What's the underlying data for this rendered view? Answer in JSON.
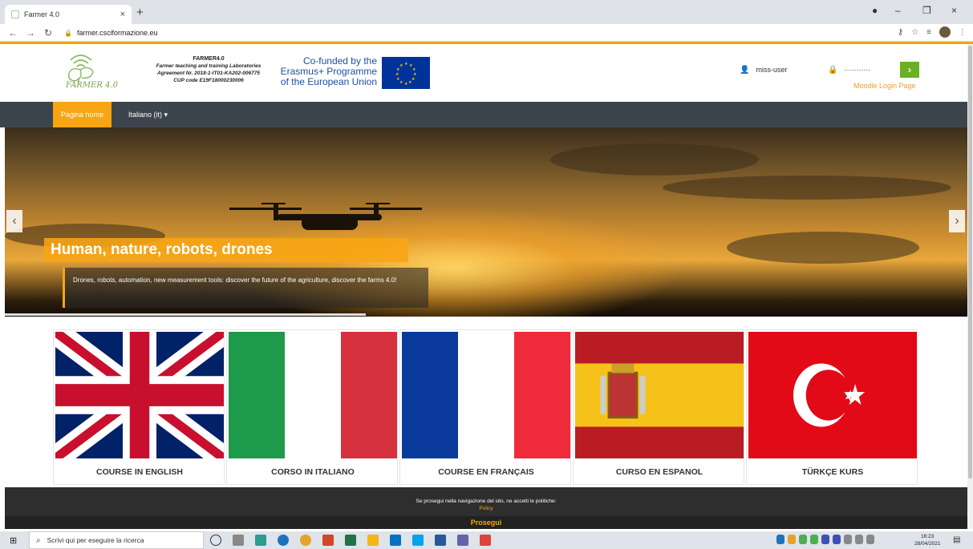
{
  "browser": {
    "tab_title": "Farmer 4.0",
    "tab_close": "×",
    "new_tab": "+",
    "url": "farmer.csciformazione.eu",
    "win_minimize": "–",
    "win_restore": "❐",
    "win_close": "×"
  },
  "header": {
    "logo_text": "FARMER 4.0",
    "project_name": "FARMER4.0",
    "project_line1": "Farmer teaching and training Laboratories",
    "project_line2": "Agreement Nr. 2018-1-IT01-KA202-006775",
    "project_line3": "CUP code E19F18000230006",
    "eu_line1": "Co-funded by the",
    "eu_line2": "Erasmus+ Programme",
    "eu_line3": "of the European Union",
    "username_value": "miss-user",
    "password_value": "···········",
    "login_button": "›",
    "moodle_link": "Moodle Login Page"
  },
  "nav": {
    "home": "Pagina home",
    "language": "Italiano (it) ▾"
  },
  "hero": {
    "title": "Human, nature, robots, drones",
    "caption": "Drones, robots, automation, new measurement tools: discover the future of the agriculture, discover the farms 4.0!",
    "prev": "‹",
    "next": "›"
  },
  "courses": [
    {
      "label": "COURSE IN ENGLISH"
    },
    {
      "label": "CORSO IN ITALIANO"
    },
    {
      "label": "COURSE EN FRANÇAIS"
    },
    {
      "label": "CURSO EN ESPANOL"
    },
    {
      "label": "TÜRKÇE KURS"
    }
  ],
  "cookie": {
    "text": "Se prosegui nella navigazione del sito, ne accetti le politiche:",
    "policy": "Policy",
    "button": "Prosegui"
  },
  "taskbar": {
    "search_placeholder": "Scrivi qui per eseguire la ricerca",
    "time": "16:23",
    "date": "28/04/2021"
  },
  "colors": {
    "accent": "#f7a513",
    "nav_bg": "#3d454c",
    "login_green": "#6ab023",
    "eu_blue": "#003399"
  }
}
